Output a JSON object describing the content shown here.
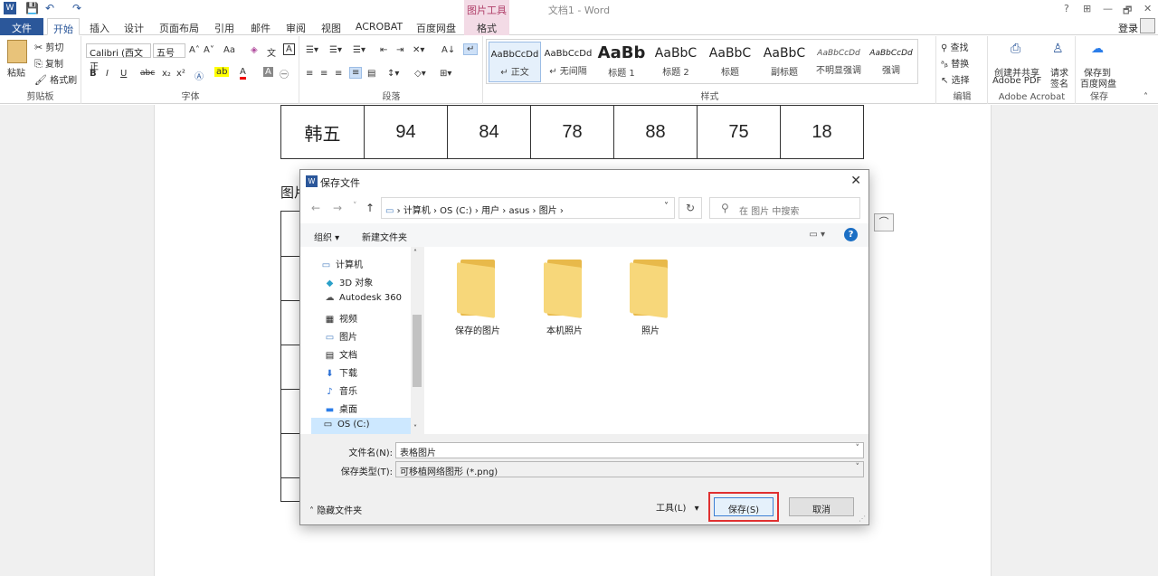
{
  "window": {
    "title": "文档1 - Word",
    "contextual_tab_group": "图片工具",
    "help": "?",
    "restore": "⊞",
    "minimize": "—",
    "maximize": "🗗",
    "close": "✕",
    "login": "登录"
  },
  "quick_access": {
    "undo": "↶",
    "redo": "↷"
  },
  "tabs": [
    "文件",
    "开始",
    "插入",
    "设计",
    "页面布局",
    "引用",
    "邮件",
    "审阅",
    "视图",
    "ACROBAT",
    "百度网盘",
    "格式"
  ],
  "ribbon": {
    "clipboard": {
      "paste": "粘贴",
      "cut": "剪切",
      "copy": "复制",
      "format_painter": "格式刷",
      "label": "剪贴板"
    },
    "font": {
      "name": "Calibri (西文正",
      "size": "五号",
      "grow": "A˄",
      "shrink": "A˅",
      "case": "Aa",
      "label": "字体",
      "bold": "B",
      "italic": "I",
      "underline": "U",
      "strike": "abc",
      "subscript": "x₂",
      "superscript": "x²"
    },
    "paragraph": {
      "label": "段落"
    },
    "styles": {
      "label": "样式",
      "items": [
        {
          "preview": "AaBbCcDd",
          "name": "↵ 正文"
        },
        {
          "preview": "AaBbCcDd",
          "name": "↵ 无间隔"
        },
        {
          "preview": "AaBb",
          "name": "标题 1"
        },
        {
          "preview": "AaBbC",
          "name": "标题 2"
        },
        {
          "preview": "AaBbC",
          "name": "标题"
        },
        {
          "preview": "AaBbC",
          "name": "副标题"
        },
        {
          "preview": "AaBbCcDd",
          "name": "不明显强调"
        },
        {
          "preview": "AaBbCcDd",
          "name": "强调"
        }
      ]
    },
    "editing": {
      "find": "查找",
      "replace": "替换",
      "select": "选择",
      "label": "编辑"
    },
    "acrobat": {
      "create_share": "创建并共享",
      "create_pdf": "Adobe PDF",
      "request": "请求",
      "sign": "签名",
      "label": "Adobe Acrobat"
    },
    "save_group": {
      "save_to": "保存到",
      "baidu": "百度网盘",
      "label": "保存"
    }
  },
  "document": {
    "table_row": [
      "韩五",
      "94",
      "84",
      "78",
      "88",
      "75",
      "18"
    ],
    "caption_partial": "图片"
  },
  "dialog": {
    "title": "保存文件",
    "breadcrumb": [
      "计算机",
      "OS (C:)",
      "用户",
      "asus",
      "图片"
    ],
    "search_placeholder": "在 图片 中搜索",
    "organize": "组织 ▾",
    "new_folder": "新建文件夹",
    "nav_items": [
      {
        "icon": "computer-icon",
        "label": "计算机"
      },
      {
        "icon": "cube-icon",
        "label": "3D 对象"
      },
      {
        "icon": "cloud-icon",
        "label": "Autodesk 360"
      },
      {
        "icon": "video-icon",
        "label": "视频"
      },
      {
        "icon": "picture-icon",
        "label": "图片"
      },
      {
        "icon": "document-icon",
        "label": "文档"
      },
      {
        "icon": "download-icon",
        "label": "下载"
      },
      {
        "icon": "music-icon",
        "label": "音乐"
      },
      {
        "icon": "desktop-icon",
        "label": "桌面"
      },
      {
        "icon": "drive-icon",
        "label": "OS (C:)"
      }
    ],
    "folders": [
      "保存的图片",
      "本机照片",
      "照片"
    ],
    "filename_label": "文件名(N):",
    "filename_value": "表格图片",
    "filetype_label": "保存类型(T):",
    "filetype_value": "可移植网络图形 (*.png)",
    "hide_folders": "隐藏文件夹",
    "tools": "工具(L)",
    "save": "保存(S)",
    "cancel": "取消"
  }
}
